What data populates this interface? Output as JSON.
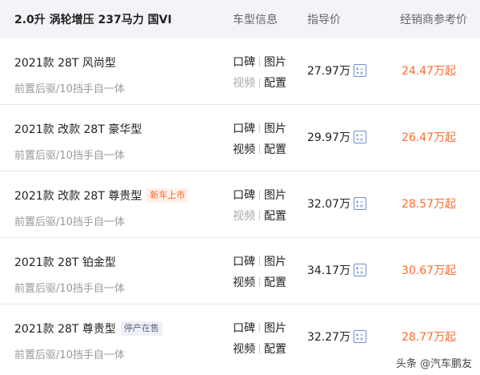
{
  "header": {
    "spec": "2.0升 涡轮增压 237马力 国VI",
    "col_info": "车型信息",
    "col_guide": "指导价",
    "col_dealer": "经销商参考价"
  },
  "links": {
    "reviews": "口碑",
    "photos": "图片",
    "videos": "视频",
    "config": "配置"
  },
  "rows": [
    {
      "name": "2021款 28T 风尚型",
      "tag": "",
      "sub": "前置后驱/10挡手自一体",
      "guide": "27.97万",
      "dealer": "24.47万起",
      "video_available": false
    },
    {
      "name": "2021款 改款 28T 豪华型",
      "tag": "",
      "sub": "前置后驱/10挡手自一体",
      "guide": "29.97万",
      "dealer": "26.47万起",
      "video_available": true
    },
    {
      "name": "2021款 改款 28T 尊贵型",
      "tag": "新车上市",
      "sub": "前置后驱/10挡手自一体",
      "guide": "32.07万",
      "dealer": "28.57万起",
      "video_available": false
    },
    {
      "name": "2021款 28T 铂金型",
      "tag": "",
      "sub": "前置后驱/10挡手自一体",
      "guide": "34.17万",
      "dealer": "30.67万起",
      "video_available": true
    },
    {
      "name": "2021款 28T 尊贵型",
      "tag": "停产在售",
      "sub": "前置后驱/10挡手自一体",
      "guide": "32.27万",
      "dealer": "28.77万起",
      "video_available": true
    }
  ],
  "watermark": "头条 @汽车鹏友",
  "colors": {
    "accent": "#ff6a2c",
    "header_bg": "#f3f4f8",
    "icon_blue": "#6a8fd8"
  }
}
